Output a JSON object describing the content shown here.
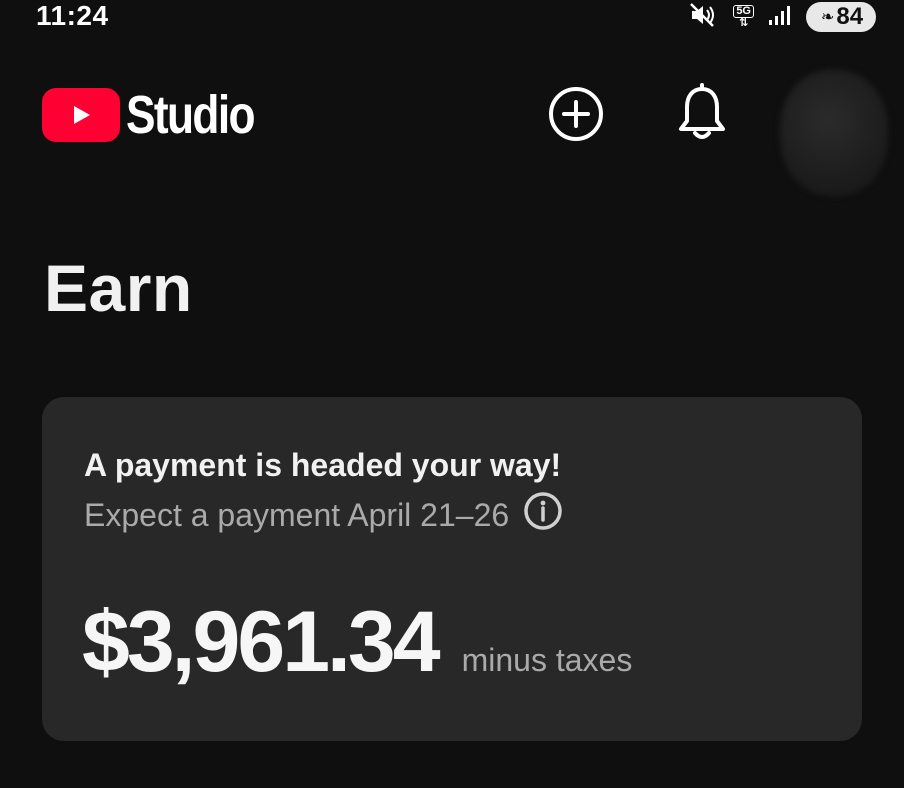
{
  "status_bar": {
    "time": "11:24",
    "network_label": "5G",
    "battery_level": "84",
    "icons": [
      "mute-icon",
      "network-5g-icon",
      "signal-icon",
      "battery-saver-icon"
    ]
  },
  "header": {
    "app_name": "Studio",
    "logo_icon": "youtube-play-icon",
    "actions": [
      "create-icon",
      "notifications-bell-icon",
      "avatar"
    ]
  },
  "page": {
    "title": "Earn"
  },
  "payment_card": {
    "heading": "A payment is headed your way!",
    "subtext": "Expect a payment April 21–26",
    "info_icon": "info-icon",
    "amount": "$3,961.34",
    "amount_note": "minus taxes"
  },
  "colors": {
    "background": "#0f0f0f",
    "card": "#282828",
    "brand_red": "#ff0033",
    "text_primary": "#f1f1f1",
    "text_secondary": "#aaaaaa"
  }
}
